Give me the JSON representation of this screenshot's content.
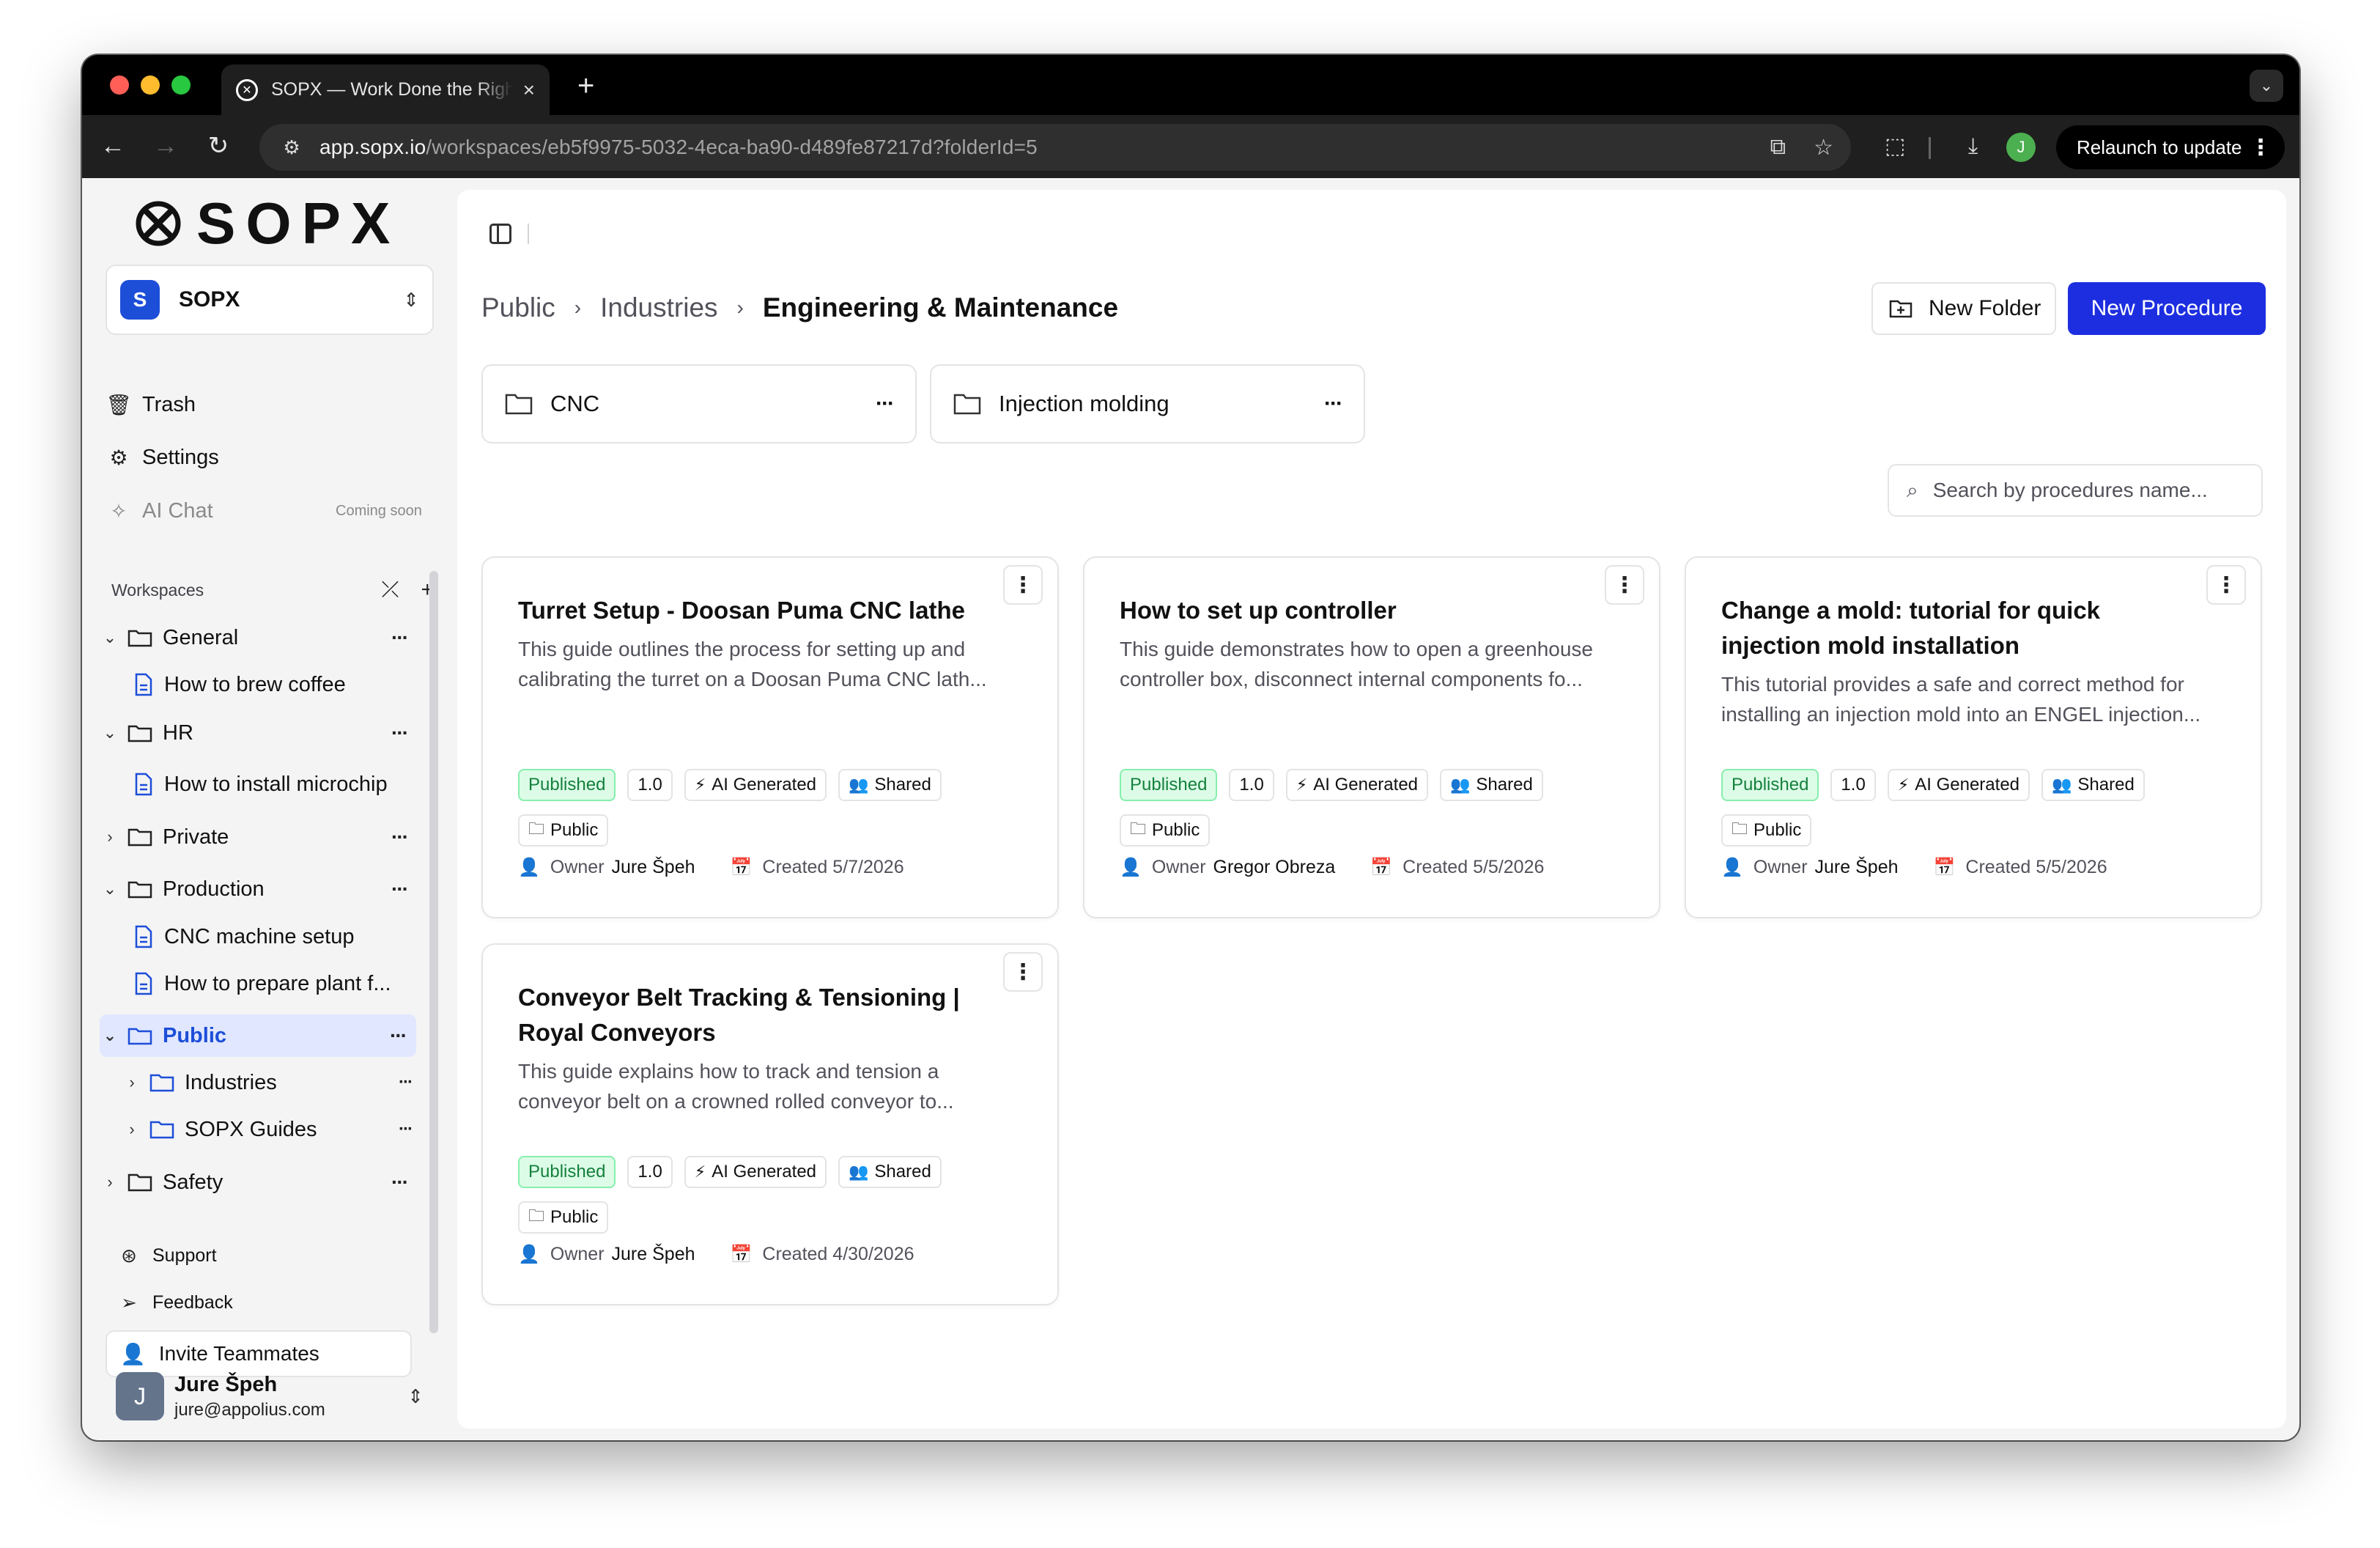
{
  "browser": {
    "tab_title": "SOPX — Work Done the Right Way",
    "tab_close": "×",
    "new_tab": "+",
    "url_host": "app.sopx.io",
    "url_path": "/workspaces/eb5f9975-5032-4eca-ba90-d489fe87217d?folderId=5",
    "profile_initial": "J",
    "relaunch_label": "Relaunch to update"
  },
  "sidebar": {
    "logo_text": "SOPX",
    "workspace": {
      "badge": "S",
      "name": "SOPX"
    },
    "links": {
      "trash": "Trash",
      "settings": "Settings",
      "ai_chat": "AI Chat",
      "coming_soon": "Coming soon"
    },
    "workspaces_heading": "Workspaces",
    "tree": {
      "general": "General",
      "brew_coffee": "How to brew coffee",
      "hr": "HR",
      "microchip": "How to install microchip",
      "private": "Private",
      "production": "Production",
      "cnc_setup": "CNC machine setup",
      "plant": "How to prepare plant f...",
      "public": "Public",
      "industries": "Industries",
      "sopx_guides": "SOPX Guides",
      "safety": "Safety"
    },
    "support": "Support",
    "feedback": "Feedback",
    "invite": "Invite Teammates",
    "user": {
      "initial": "J",
      "name": "Jure Špeh",
      "email": "jure@appolius.com"
    }
  },
  "main": {
    "breadcrumb": {
      "root": "Public",
      "middle": "Industries",
      "current": "Engineering & Maintenance"
    },
    "new_folder": "New Folder",
    "new_procedure": "New Procedure",
    "folders": [
      "CNC",
      "Injection molding"
    ],
    "search_placeholder": "Search by procedures name...",
    "tag_labels": {
      "published": "Published",
      "version": "1.0",
      "ai": "AI Generated",
      "shared": "Shared",
      "public": "Public"
    },
    "owner_label": "Owner",
    "created_label": "Created",
    "cards": [
      {
        "title": "Turret Setup - Doosan Puma CNC lathe",
        "desc": "This guide outlines the process for setting up and calibrating the turret on a Doosan Puma CNC lath...",
        "owner": "Jure Špeh",
        "created": "5/7/2026"
      },
      {
        "title": "How to set up controller",
        "desc": "This guide demonstrates how to open a greenhouse controller box, disconnect internal components fo...",
        "owner": "Gregor Obreza",
        "created": "5/5/2026"
      },
      {
        "title": "Change a mold: tutorial for quick injection mold installation",
        "desc": "This tutorial provides a safe and correct method for installing an injection mold into an ENGEL injection...",
        "owner": "Jure Špeh",
        "created": "5/5/2026"
      },
      {
        "title": "Conveyor Belt Tracking & Tensioning | Royal Conveyors",
        "desc": "This guide explains how to track and tension a conveyor belt on a crowned rolled conveyor to...",
        "owner": "Jure Špeh",
        "created": "4/30/2026"
      }
    ]
  },
  "colors": {
    "accent": "#1d2ee0",
    "published_bg": "#dcfce7",
    "published_text": "#15803d",
    "active_bg": "#e0e7ff"
  }
}
